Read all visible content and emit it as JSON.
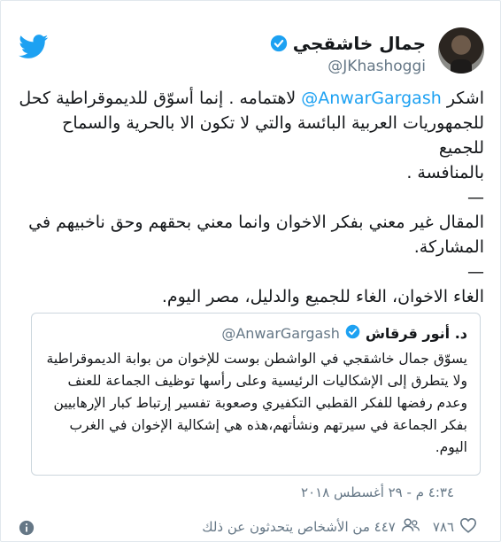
{
  "author": {
    "display_name": "جمال خاشقجي",
    "handle": "@JKhashoggi"
  },
  "tweet": {
    "line1_prefix": "اشكر",
    "line1_mention": "@AnwarGargash",
    "line1_suffix": "لاهتمامه . إنما أسوّق للديموقراطية كحل",
    "line2": "للجمهوريات العربية البائسة والتي لا تكون الا بالحرية والسماح للجميع",
    "line3": "بالمنافسة .",
    "dash1": "—",
    "line4": "المقال غير معني بفكر الاخوان وانما معني بحقهم وحق ناخبيهم في",
    "line5": "المشاركة.",
    "dash2": "—",
    "line6": "الغاء الاخوان، الغاء للجميع والدليل،  مصر اليوم."
  },
  "quoted": {
    "display_name": "د. أنور قرقاش",
    "handle": "@AnwarGargash",
    "lines": [
      "يسوّق جمال خاشقجي في الواشطن بوست للإخوان من بوابة الديموقراطية",
      "ولا يتطرق إلى الإشكاليات الرئيسية وعلى رأسها توظيف الجماعة للعنف",
      "وعدم رفضها للفكر القطبي التكفيري وصعوبة تفسير إرتباط كبار الإرهابيين",
      "بفكر الجماعة في سيرتهم ونشأتهم،هذه هي إشكالية الإخوان في الغرب",
      "اليوم."
    ]
  },
  "timestamp": "٤:٣٤ م - ٢٩ أغسطس ٢٠١٨",
  "actions": {
    "likes": "٧٨٦",
    "talking": "٤٤٧ من الأشخاص يتحدثون عن ذلك"
  },
  "colors": {
    "twitter_blue": "#1da1f2",
    "secondary_text": "#657786"
  }
}
